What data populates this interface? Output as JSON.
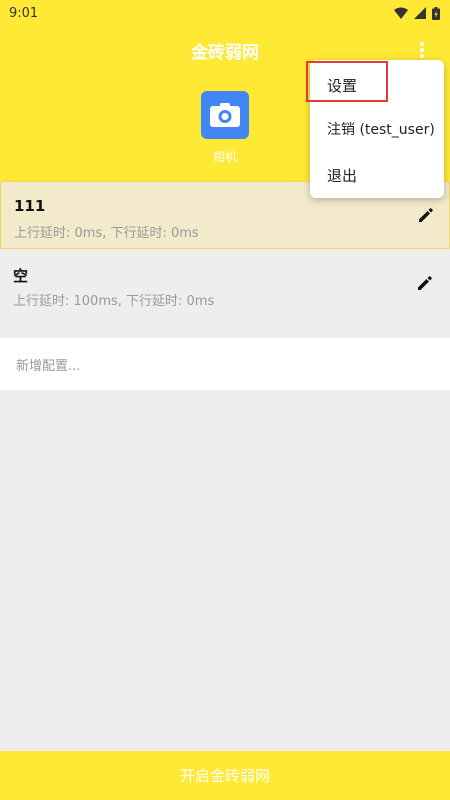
{
  "status_bar": {
    "time": "9:01"
  },
  "header": {
    "title": "金砖弱网",
    "app_label": "相机",
    "app_icon": "camera-icon"
  },
  "configs": [
    {
      "name": "111",
      "delay": "上行延时: 0ms, 下行延时: 0ms",
      "selected": true
    },
    {
      "name": "空",
      "delay": "上行延时: 100ms, 下行延时: 0ms",
      "selected": false
    }
  ],
  "add_config_placeholder": "新增配置...",
  "start_button_label": "开启金砖弱网",
  "menu": {
    "items": [
      {
        "label": "设置"
      },
      {
        "label": "注销 (test_user)"
      },
      {
        "label": "退出"
      }
    ]
  },
  "colors": {
    "accent": "#ffe935",
    "selected_bg": "#f3e9cb",
    "highlight": "#e53935"
  }
}
